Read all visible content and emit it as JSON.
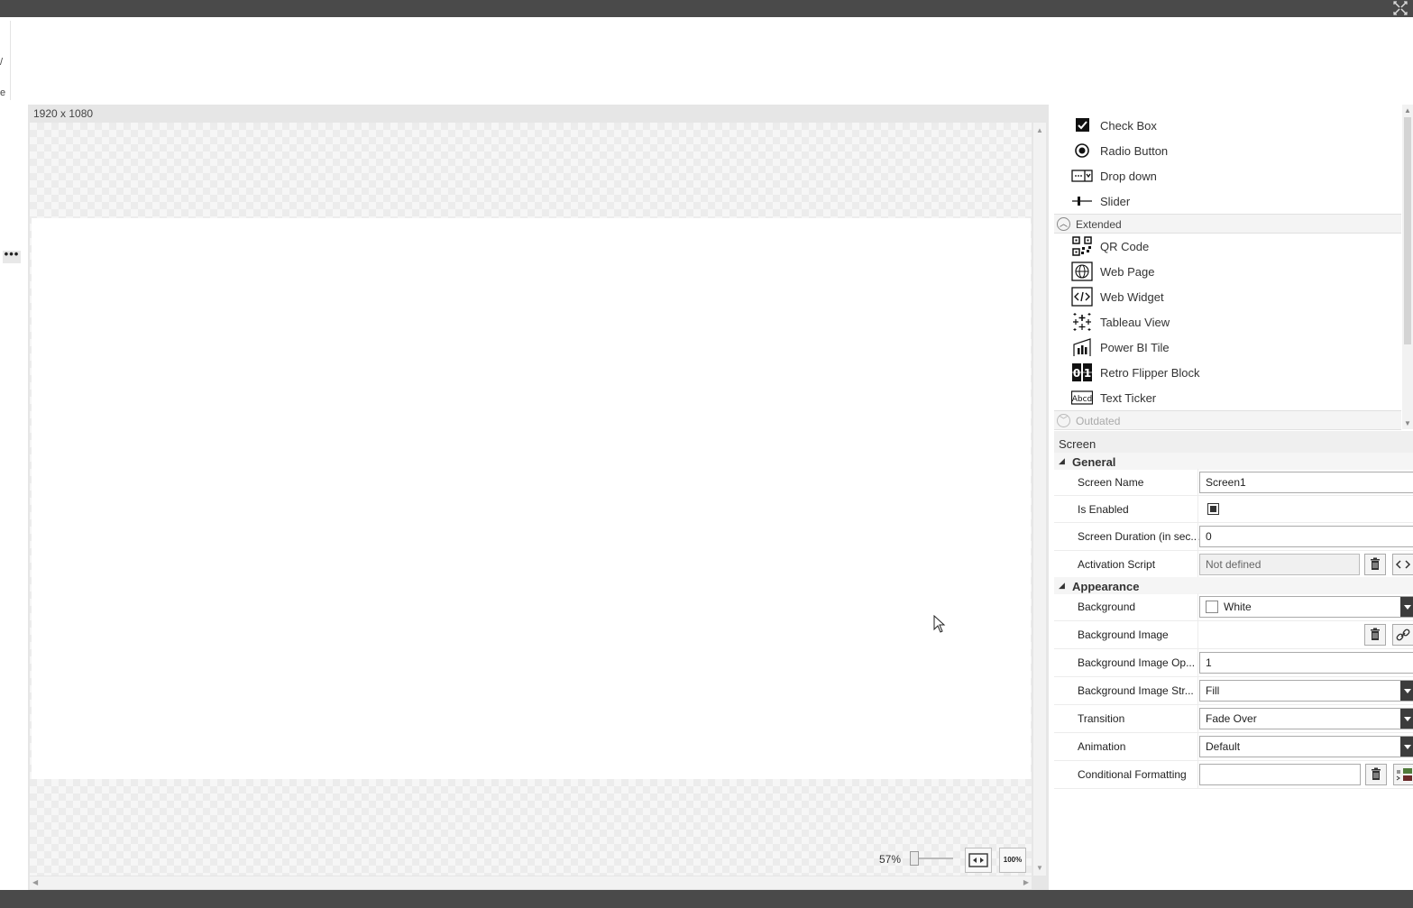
{
  "canvas": {
    "size_label": "1920 x 1080",
    "zoom_percent": "57%",
    "fit_button": "fit-screen",
    "actual_size_label": "100%"
  },
  "ribbon": {
    "frag1": "/",
    "frag2": "e"
  },
  "left_panel": {
    "more_label": "•••"
  },
  "toolbox": {
    "items_top": [
      {
        "label": "Check Box",
        "icon": "checkbox-icon"
      },
      {
        "label": "Radio Button",
        "icon": "radio-icon"
      },
      {
        "label": "Drop down",
        "icon": "dropdown-icon"
      },
      {
        "label": "Slider",
        "icon": "slider-icon"
      }
    ],
    "extended_label": "Extended",
    "items_extended": [
      {
        "label": "QR Code",
        "icon": "qr-code-icon"
      },
      {
        "label": "Web Page",
        "icon": "globe-icon"
      },
      {
        "label": "Web Widget",
        "icon": "code-icon"
      },
      {
        "label": "Tableau View",
        "icon": "tableau-icon"
      },
      {
        "label": "Power BI Tile",
        "icon": "powerbi-icon"
      },
      {
        "label": "Retro Flipper Block",
        "icon": "flipper-icon"
      },
      {
        "label": "Text Ticker",
        "icon": "ticker-icon"
      }
    ],
    "outdated_label": "Outdated"
  },
  "properties": {
    "header": "Screen",
    "general": {
      "label": "General",
      "screen_name_label": "Screen Name",
      "screen_name_value": "Screen1",
      "is_enabled_label": "Is Enabled",
      "is_enabled": true,
      "duration_label": "Screen Duration (in sec...",
      "duration_value": "0",
      "activation_label": "Activation Script",
      "activation_value": "Not defined"
    },
    "appearance": {
      "label": "Appearance",
      "background_label": "Background",
      "background_value": "White",
      "bg_image_label": "Background Image",
      "bg_opacity_label": "Background Image Op...",
      "bg_opacity_value": "1",
      "bg_stretch_label": "Background Image Str...",
      "bg_stretch_value": "Fill",
      "transition_label": "Transition",
      "transition_value": "Fade Over",
      "animation_label": "Animation",
      "animation_value": "Default",
      "cond_format_label": "Conditional Formatting",
      "cond_format_value": ""
    }
  },
  "colors": {
    "chrome_dark": "#4a4a4a",
    "dropdown_btn": "#3c3c3c"
  }
}
